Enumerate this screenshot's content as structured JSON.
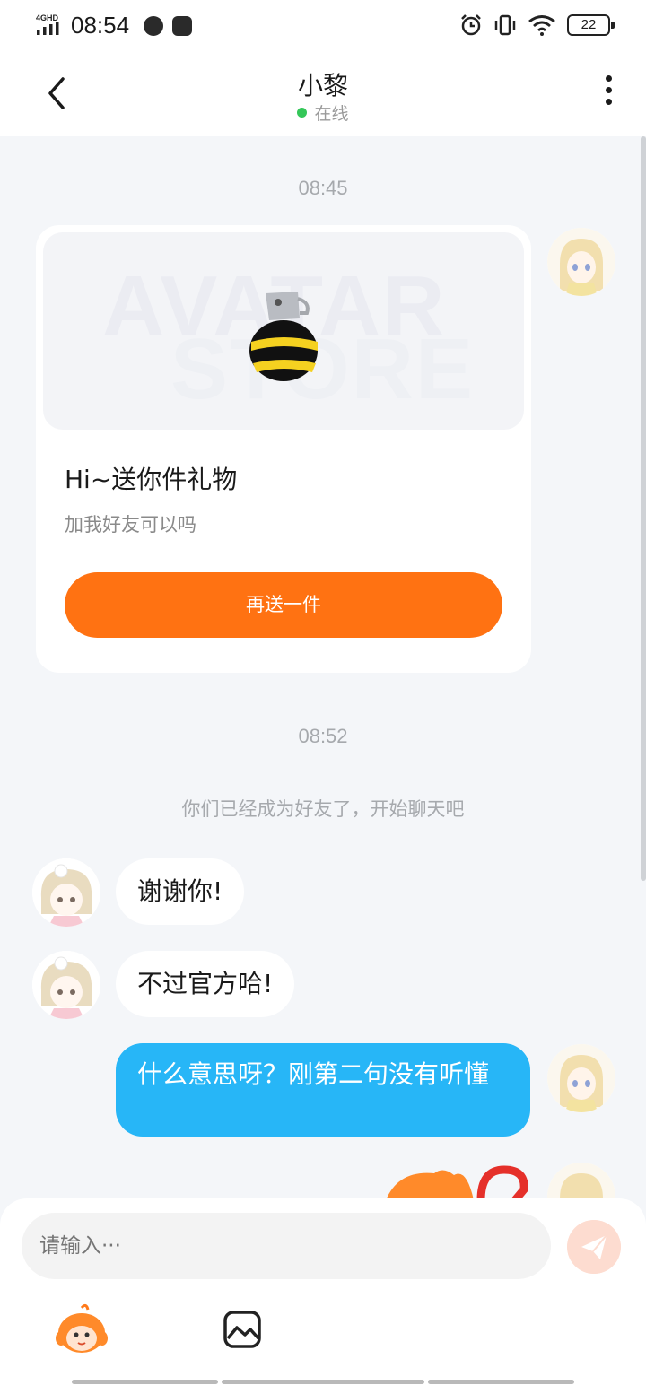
{
  "status_bar": {
    "network": "4GHD",
    "time": "08:54",
    "battery": "22"
  },
  "header": {
    "title": "小黎",
    "status": "在线"
  },
  "messages": {
    "time1": "08:45",
    "gift_card": {
      "watermark_line1": "AVATAR",
      "watermark_line2": "STORE",
      "title": "Hi~送你件礼物",
      "subtitle": "加我好友可以吗",
      "button": "再送一件"
    },
    "time2": "08:52",
    "system_notice": "你们已经成为好友了，开始聊天吧",
    "incoming": [
      {
        "text": "谢谢你!"
      },
      {
        "text": "不过官方哈!"
      }
    ],
    "outgoing": [
      {
        "text": "什么意思呀？刚第二句没有听懂"
      }
    ]
  },
  "composer": {
    "placeholder": "请输入···"
  },
  "icons": {
    "send": "paper-plane-icon",
    "emoji": "mascot-sticker-icon",
    "image": "image-icon"
  },
  "colors": {
    "accent_orange": "#ff7212",
    "bubble_blue": "#27b6f7",
    "online_green": "#34c759"
  }
}
